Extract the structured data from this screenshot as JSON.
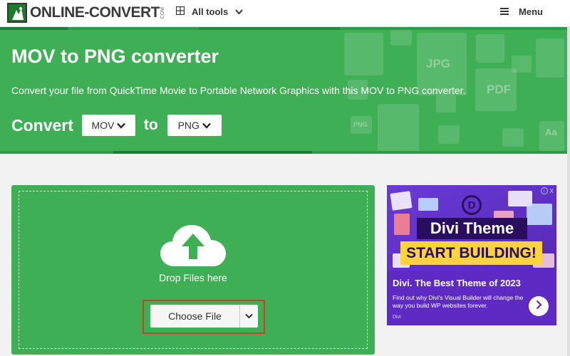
{
  "header": {
    "logo_text": "ONLINE-CONVERT",
    "logo_suffix": "COM",
    "all_tools_label": "All tools",
    "menu_label": "Menu"
  },
  "hero": {
    "title": "MOV to PNG converter",
    "description": "Convert your file from QuickTime Movie to Portable Network Graphics with this MOV to PNG converter.",
    "convert_label": "Convert",
    "from_format": "MOV",
    "to_label": "to",
    "to_format": "PNG",
    "decor_labels": [
      "JPG",
      "PDF",
      "PNG",
      "Aa"
    ]
  },
  "upload": {
    "drop_text": "Drop Files here",
    "choose_file_label": "Choose File"
  },
  "ad": {
    "logo_letter": "D",
    "title": "Divi Theme",
    "cta": "START BUILDING!",
    "headline": "Divi. The Best Theme of 2023",
    "body": "Find out why Divi's Visual Builder will change the way you build WP websites forever.",
    "brand": "Divi",
    "info_icon": "i",
    "close_icon": "x"
  },
  "colors": {
    "brand_green": "#3faf56",
    "dark_green": "#1d7d34",
    "highlight_red": "#d63a2f",
    "ad_purple": "#5d2bc4",
    "ad_yellow": "#ffd33d"
  }
}
